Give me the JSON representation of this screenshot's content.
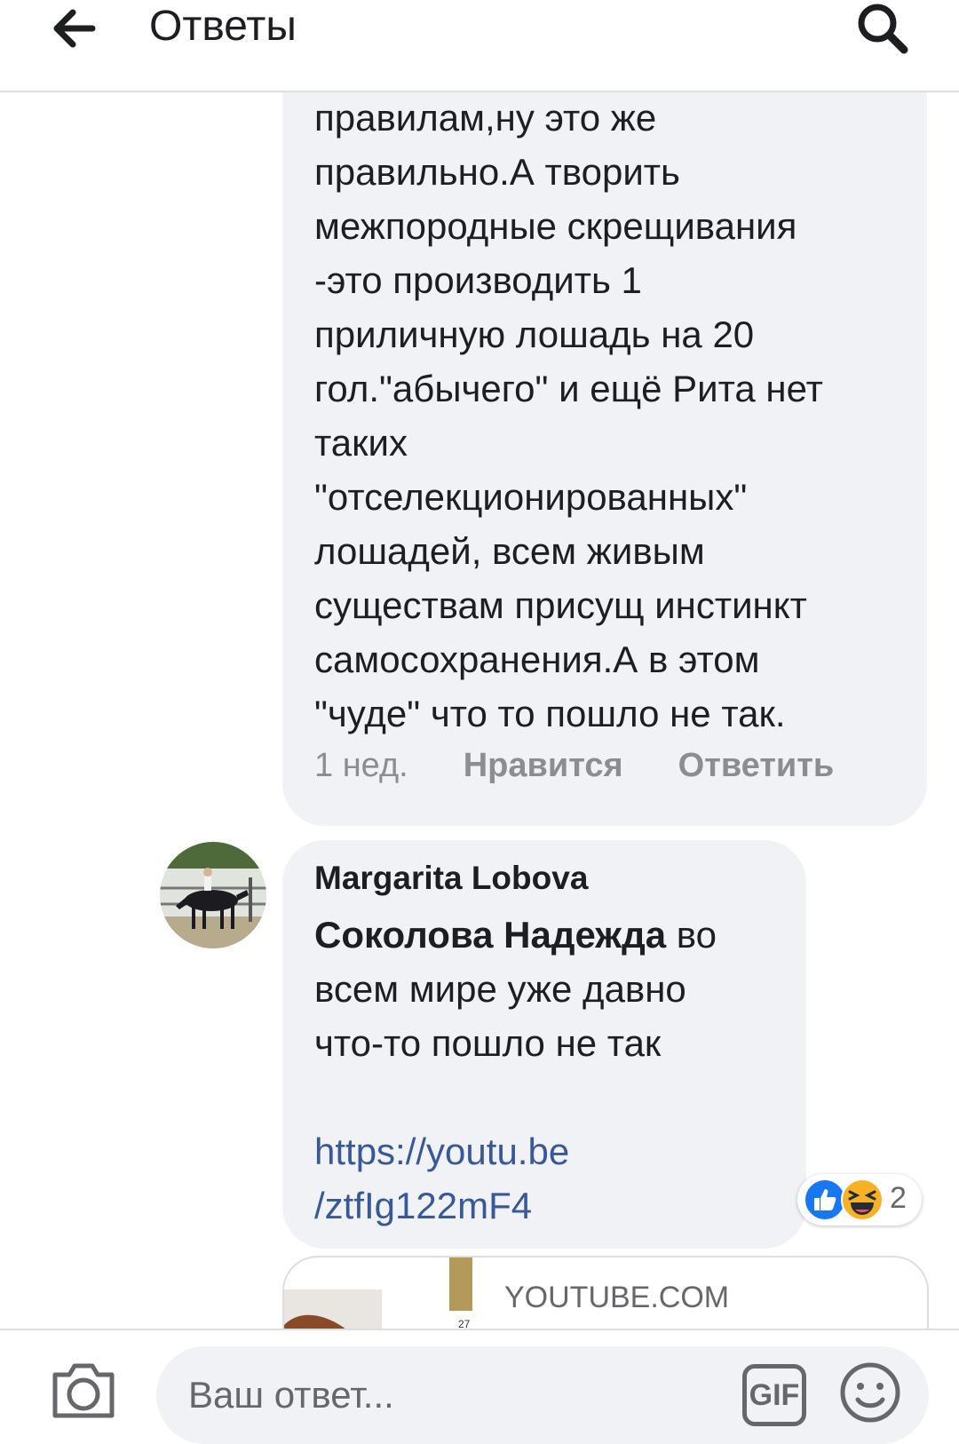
{
  "header": {
    "title": "Ответы"
  },
  "comment1": {
    "lines": [
      "правилам,ну это же",
      "правильно.А творить",
      "межпородные скрещивания",
      "-это производить 1",
      "приличную лошадь на 20",
      "гол.\"абычего\" и ещё Рита нет",
      "таких",
      "\"отселекционированных\"",
      "лошадей, всем живым",
      "существам присущ инстинкт",
      "самосохранения.А в этом",
      "\"чуде\" что то пошло не так."
    ],
    "time": "1 нед.",
    "like_label": "Нравится",
    "reply_label": "Ответить"
  },
  "comment2": {
    "author": "Margarita Lobova",
    "mention": "Соколова Надежда",
    "text_after_mention": " во",
    "line2": "всем мире уже давно",
    "line3": "что-то пошло не так",
    "link_line1": "https://youtu.be",
    "link_line2": "/ztfIg122mF4",
    "reactions": {
      "icons": [
        "like-reaction",
        "haha-reaction"
      ],
      "count": "2"
    }
  },
  "link_preview": {
    "domain": "YOUTUBE.COM",
    "thumb_number": "27"
  },
  "footer": {
    "reply_placeholder": "Ваш ответ...",
    "gif_label": "GIF"
  },
  "colors": {
    "link": "#385898",
    "bubble": "#f0f2f5",
    "muted": "#8a8d91",
    "like_blue": "#1877f2"
  }
}
